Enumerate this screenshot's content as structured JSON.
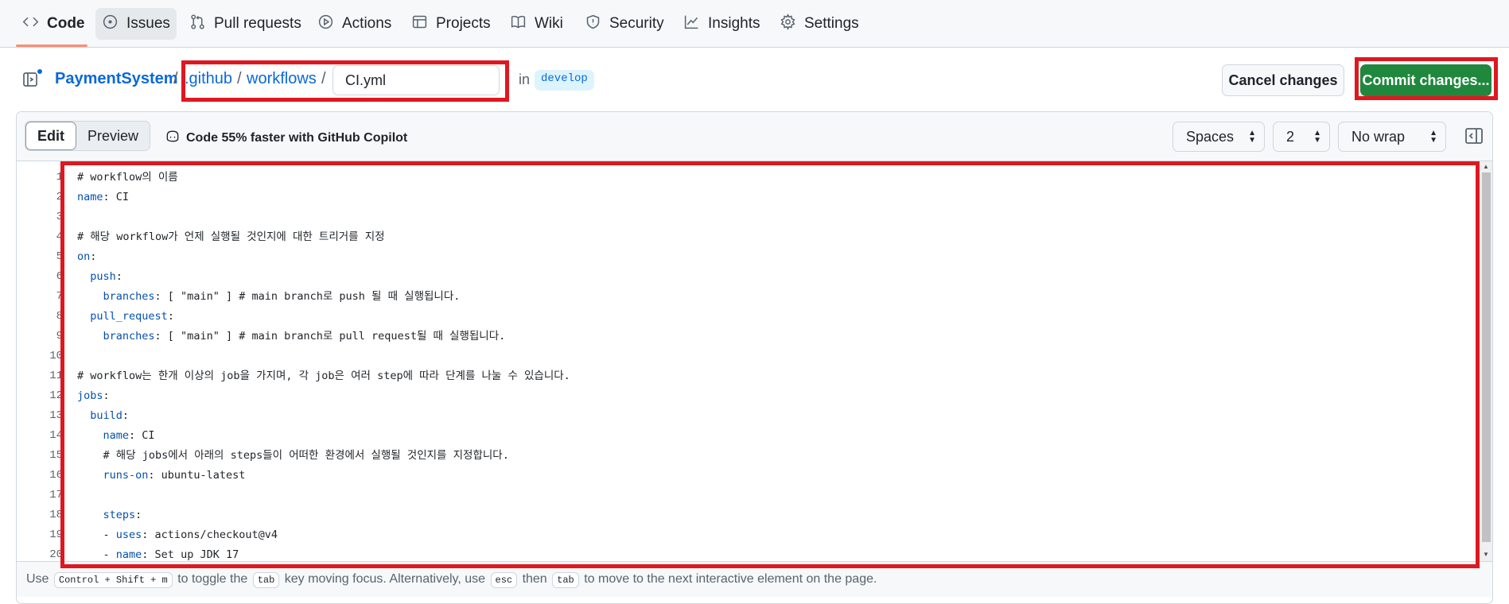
{
  "nav": {
    "tabs": [
      {
        "label": "Code",
        "icon": "code-icon"
      },
      {
        "label": "Issues",
        "icon": "issue-icon"
      },
      {
        "label": "Pull requests",
        "icon": "pull-request-icon"
      },
      {
        "label": "Actions",
        "icon": "play-icon"
      },
      {
        "label": "Projects",
        "icon": "table-icon"
      },
      {
        "label": "Wiki",
        "icon": "book-icon"
      },
      {
        "label": "Security",
        "icon": "shield-icon"
      },
      {
        "label": "Insights",
        "icon": "graph-icon"
      },
      {
        "label": "Settings",
        "icon": "gear-icon"
      }
    ]
  },
  "breadcrumb": {
    "repo": "PaymentSystem",
    "sep": "/",
    "dir1": ".github",
    "dir2": "workflows",
    "filename": "CI.yml",
    "in_label": "in",
    "branch": "develop"
  },
  "actions": {
    "cancel": "Cancel changes",
    "commit": "Commit changes..."
  },
  "toolbar": {
    "edit": "Edit",
    "preview": "Preview",
    "copilot": "Code 55% faster with GitHub Copilot",
    "indent_mode": "Spaces",
    "indent_size": "2",
    "wrap_mode": "No wrap"
  },
  "code_lines": [
    {
      "n": "1",
      "key": "",
      "rest": "# workflow의 이름"
    },
    {
      "n": "2",
      "key": "name",
      "rest": ": CI"
    },
    {
      "n": "3",
      "key": "",
      "rest": ""
    },
    {
      "n": "4",
      "key": "",
      "rest": "# 해당 workflow가 언제 실행될 것인지에 대한 트리거를 지정"
    },
    {
      "n": "5",
      "key": "on",
      "rest": ":"
    },
    {
      "n": "6",
      "indent": "  ",
      "key": "push",
      "rest": ":"
    },
    {
      "n": "7",
      "indent": "    ",
      "key": "branches",
      "rest": ": [ \"main\" ] # main branch로 push 될 때 실행됩니다."
    },
    {
      "n": "8",
      "indent": "  ",
      "key": "pull_request",
      "rest": ":"
    },
    {
      "n": "9",
      "indent": "    ",
      "key": "branches",
      "rest": ": [ \"main\" ] # main branch로 pull request될 때 실행됩니다."
    },
    {
      "n": "10",
      "key": "",
      "rest": ""
    },
    {
      "n": "11",
      "key": "",
      "rest": "# workflow는 한개 이상의 job을 가지며, 각 job은 여러 step에 따라 단계를 나눌 수 있습니다."
    },
    {
      "n": "12",
      "key": "jobs",
      "rest": ":"
    },
    {
      "n": "13",
      "indent": "  ",
      "key": "build",
      "rest": ":"
    },
    {
      "n": "14",
      "indent": "    ",
      "key": "name",
      "rest": ": CI"
    },
    {
      "n": "15",
      "indent": "    ",
      "key": "",
      "rest": "# 해당 jobs에서 아래의 steps들이 어떠한 환경에서 실행될 것인지를 지정합니다."
    },
    {
      "n": "16",
      "indent": "    ",
      "key": "runs-on",
      "rest": ": ubuntu-latest"
    },
    {
      "n": "17",
      "key": "",
      "rest": ""
    },
    {
      "n": "18",
      "indent": "    ",
      "key": "steps",
      "rest": ":"
    },
    {
      "n": "19",
      "indent": "    ",
      "pre": "- ",
      "key": "uses",
      "rest": ": actions/checkout@v4"
    },
    {
      "n": "20",
      "indent": "    ",
      "pre": "- ",
      "key": "name",
      "rest": ": Set up JDK 17"
    }
  ],
  "footer": {
    "t1": "Use",
    "k1": "Control + Shift + m",
    "t2": "to toggle the",
    "k2": "tab",
    "t3": "key moving focus. Alternatively, use",
    "k3": "esc",
    "t4": "then",
    "k4": "tab",
    "t5": "to move to the next interactive element on the page."
  },
  "colors": {
    "primary_button": "#1f883d",
    "link": "#0969da",
    "yaml_key": "#0550ae",
    "annotation": "#e0171f"
  }
}
